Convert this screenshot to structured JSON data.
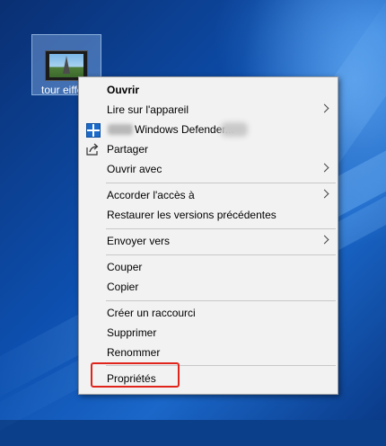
{
  "desktop": {
    "icon_label": "tour eiffel"
  },
  "context_menu": {
    "items": [
      {
        "label": "Ouvrir",
        "bold": true
      },
      {
        "label": "Lire sur l'appareil",
        "submenu": true
      },
      {
        "label": "Windows Defender...",
        "icon": "windows-defender-icon"
      },
      {
        "label": "Partager",
        "icon": "share-icon"
      },
      {
        "label": "Ouvrir avec",
        "submenu": true
      },
      {
        "label": "Accorder l'accès à",
        "submenu": true
      },
      {
        "label": "Restaurer les versions précédentes"
      },
      {
        "label": "Envoyer vers",
        "submenu": true
      },
      {
        "label": "Couper"
      },
      {
        "label": "Copier"
      },
      {
        "label": "Créer un raccourci"
      },
      {
        "label": "Supprimer"
      },
      {
        "label": "Renommer"
      },
      {
        "label": "Propriétés",
        "highlighted": true
      }
    ]
  },
  "colors": {
    "highlight_border": "#e0241b",
    "menu_background": "#f2f2f2",
    "defender_blue": "#1b6ac9"
  }
}
